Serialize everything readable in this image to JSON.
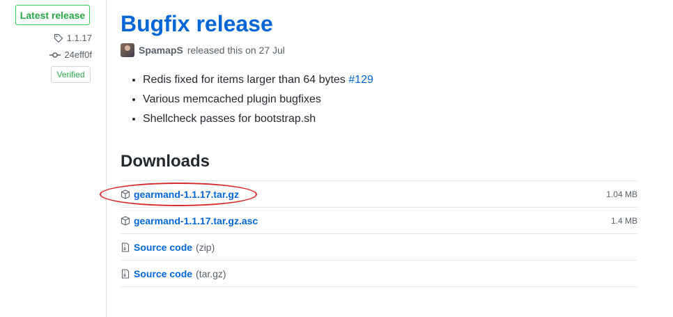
{
  "sidebar": {
    "latest_label": "Latest release",
    "tag": "1.1.17",
    "commit": "24eff0f",
    "verified": "Verified"
  },
  "release": {
    "title": "Bugfix release",
    "author": "SpamapS",
    "released_text": "released this on 27 Jul",
    "notes": [
      {
        "text": "Redis fixed for items larger than 64 bytes",
        "link": "#129"
      },
      {
        "text": "Various memcached plugin bugfixes"
      },
      {
        "text": "Shellcheck passes for bootstrap.sh"
      }
    ]
  },
  "downloads": {
    "heading": "Downloads",
    "assets": [
      {
        "name": "gearmand-1.1.17.tar.gz",
        "size": "1.04 MB",
        "icon": "package-icon"
      },
      {
        "name": "gearmand-1.1.17.tar.gz.asc",
        "size": "1.4 MB",
        "icon": "package-icon"
      },
      {
        "name": "Source code",
        "suffix": "(zip)",
        "icon": "file-zip-icon"
      },
      {
        "name": "Source code",
        "suffix": "(tar.gz)",
        "icon": "file-zip-icon"
      }
    ]
  },
  "colors": {
    "link": "#0366d6",
    "verified_green": "#28a745",
    "highlight": "#d42a2a"
  }
}
